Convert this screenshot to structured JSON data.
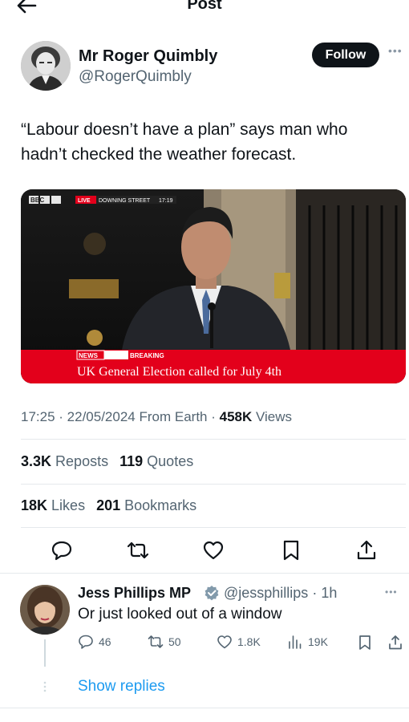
{
  "header": {
    "title": "Post",
    "back_icon": "arrow-left-icon"
  },
  "post": {
    "author_name": "Mr Roger Quimbly",
    "author_handle": "@RogerQuimbly",
    "follow_label": "Follow",
    "more_icon": "more-horizontal-icon",
    "text": "“Labour doesn’t have a plan” says man who hadn’t checked the weather forecast.",
    "media": {
      "bbc_logo": "BBC",
      "live_label": "LIVE",
      "location": "DOWNING STREET",
      "time": "17:19",
      "news_label": "NEWS",
      "breaking_label": "BREAKING",
      "headline": "UK General Election called for July 4th"
    },
    "meta": {
      "time": "17:25",
      "date": "22/05/2024",
      "source": "From Earth",
      "views_count": "458K",
      "views_label": "Views"
    },
    "stats": {
      "reposts_count": "3.3K",
      "reposts_label": "Reposts",
      "quotes_count": "119",
      "quotes_label": "Quotes",
      "likes_count": "18K",
      "likes_label": "Likes",
      "bookmarks_count": "201",
      "bookmarks_label": "Bookmarks"
    },
    "actions": [
      "reply-icon",
      "repost-icon",
      "like-icon",
      "bookmark-icon",
      "share-icon"
    ]
  },
  "reply": {
    "author_name": "Jess Phillips MP",
    "author_handle": "@jessphillips",
    "time": "1h",
    "text": "Or just looked out of a window",
    "replies_count": "46",
    "reposts_count": "50",
    "likes_count": "1.8K",
    "views_count": "19K",
    "show_replies_label": "Show replies"
  },
  "colors": {
    "accent": "#1d9bf0",
    "text_primary": "#0f1419",
    "text_secondary": "#536471",
    "bbc_red": "#e3001b"
  }
}
